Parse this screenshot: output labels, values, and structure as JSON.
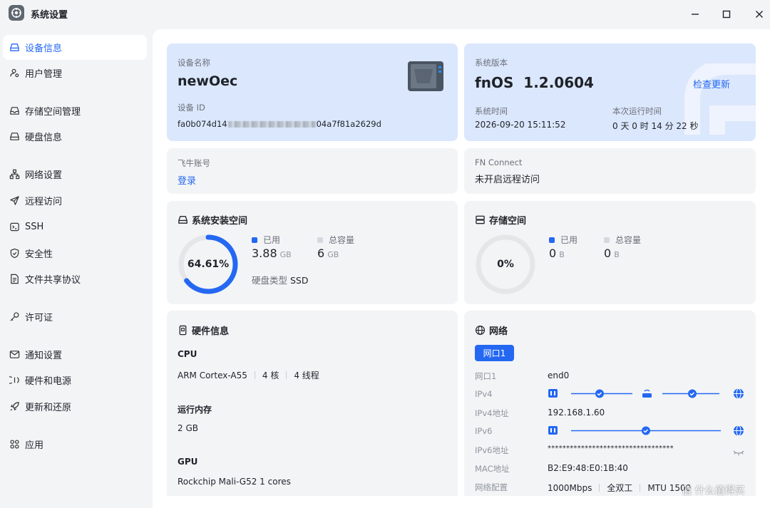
{
  "window": {
    "title": "系统设置"
  },
  "sidebar": {
    "items": [
      {
        "label": "设备信息",
        "icon": "hard-drive-icon",
        "active": true
      },
      {
        "label": "用户管理",
        "icon": "users-icon"
      },
      {
        "label": "存储空间管理",
        "icon": "storage-icon"
      },
      {
        "label": "硬盘信息",
        "icon": "disk-icon"
      },
      {
        "label": "网络设置",
        "icon": "network-icon"
      },
      {
        "label": "远程访问",
        "icon": "send-icon"
      },
      {
        "label": "SSH",
        "icon": "terminal-icon"
      },
      {
        "label": "安全性",
        "icon": "shield-icon"
      },
      {
        "label": "文件共享协议",
        "icon": "file-icon"
      },
      {
        "label": "许可证",
        "icon": "key-icon"
      },
      {
        "label": "通知设置",
        "icon": "mail-icon"
      },
      {
        "label": "硬件和电源",
        "icon": "power-icon"
      },
      {
        "label": "更新和还原",
        "icon": "rocket-icon"
      },
      {
        "label": "应用",
        "icon": "apps-icon"
      }
    ]
  },
  "device": {
    "name_label": "设备名称",
    "name": "newOec",
    "id_label": "设备 ID",
    "id_prefix": "fa0b074d14",
    "id_suffix": "04a7f81a2629d"
  },
  "system": {
    "version_label": "系统版本",
    "version": "fnOS  1.2.0604",
    "check_update": "检查更新",
    "time_label": "系统时间",
    "time": "2026-09-20 15:11:52",
    "uptime_label": "本次运行时间",
    "uptime": "0 天 0 时 14 分 22 秒"
  },
  "account": {
    "label": "飞牛账号",
    "login": "登录"
  },
  "fn_connect": {
    "label": "FN Connect",
    "status": "未开启远程访问"
  },
  "system_space": {
    "title": "系统安装空间",
    "percent_text": "64.61%",
    "used_fraction": 0.6461,
    "used_label": "已用",
    "used_value": "3.88",
    "used_unit": "GB",
    "total_label": "总容量",
    "total_value": "6",
    "total_unit": "GB",
    "disk_type_label": "硬盘类型",
    "disk_type": "SSD"
  },
  "storage_space": {
    "title": "存储空间",
    "percent_text": "0%",
    "used_fraction": 0,
    "used_label": "已用",
    "used_value": "0",
    "used_unit": "B",
    "total_label": "总容量",
    "total_value": "0",
    "total_unit": "B"
  },
  "hardware": {
    "title": "硬件信息",
    "cpu_title": "CPU",
    "cpu_model": "ARM Cortex-A55",
    "cpu_cores": "4 核",
    "cpu_threads": "4 线程",
    "ram_title": "运行内存",
    "ram": "2 GB",
    "gpu_title": "GPU",
    "gpu": "Rockchip Mali-G52 1 cores"
  },
  "network": {
    "title": "网络",
    "tab": "网口1",
    "rows": [
      {
        "label": "网口1",
        "value": "end0"
      },
      {
        "label": "IPv4",
        "value": ""
      },
      {
        "label": "IPv4地址",
        "value": "192.168.1.60"
      },
      {
        "label": "IPv6",
        "value": ""
      },
      {
        "label": "IPv6地址",
        "value": "**********************************"
      },
      {
        "label": "MAC地址",
        "value": "B2:E9:48:E0:1B:40"
      },
      {
        "label": "网络配置",
        "value": ""
      }
    ],
    "speed": "1000Mbps",
    "duplex": "全双工",
    "mtu": "MTU 1500"
  },
  "watermark": "值 什么值得买",
  "colors": {
    "accent": "#2468f2",
    "card_blue": "#dbe7fc",
    "card_gray": "#f3f4f6",
    "ring_track": "#e5e6e8"
  }
}
